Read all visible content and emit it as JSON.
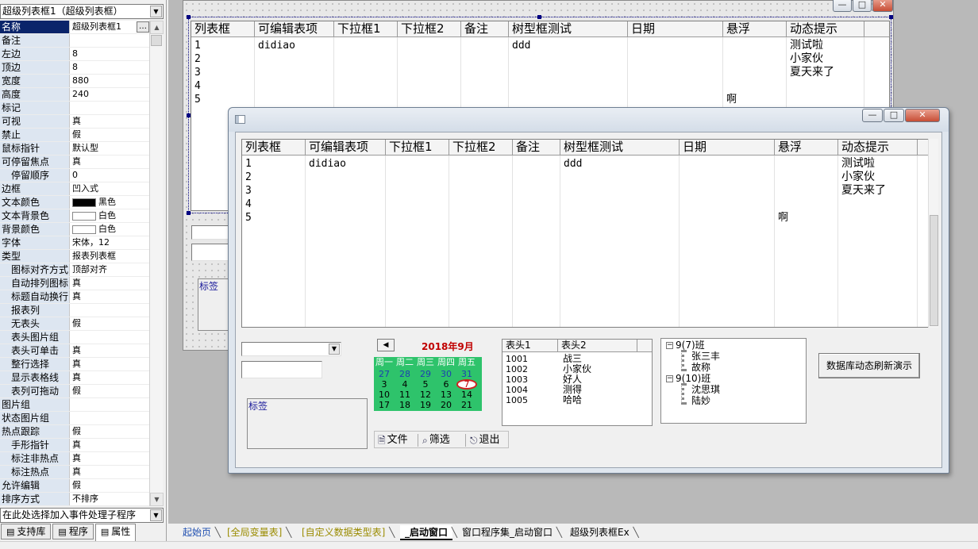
{
  "object_selector": {
    "value": "超级列表框1（超级列表框）"
  },
  "properties": [
    {
      "name": "名称",
      "value": "超级列表框1",
      "selected": true,
      "sub": false
    },
    {
      "name": "备注",
      "value": "",
      "sub": false
    },
    {
      "name": "左边",
      "value": "8",
      "sub": false
    },
    {
      "name": "顶边",
      "value": "8",
      "sub": false
    },
    {
      "name": "宽度",
      "value": "880",
      "sub": false
    },
    {
      "name": "高度",
      "value": "240",
      "sub": false
    },
    {
      "name": "标记",
      "value": "",
      "sub": false
    },
    {
      "name": "可视",
      "value": "真",
      "sub": false
    },
    {
      "name": "禁止",
      "value": "假",
      "sub": false
    },
    {
      "name": "鼠标指针",
      "value": "默认型",
      "sub": false
    },
    {
      "name": "可停留焦点",
      "value": "真",
      "sub": false
    },
    {
      "name": "停留顺序",
      "value": "0",
      "sub": true
    },
    {
      "name": "边框",
      "value": "凹入式",
      "sub": false
    },
    {
      "name": "文本颜色",
      "value": "黑色",
      "swatch": "#000000",
      "sub": false
    },
    {
      "name": "文本背景色",
      "value": "白色",
      "swatch": "#ffffff",
      "sub": false
    },
    {
      "name": "背景颜色",
      "value": "白色",
      "swatch": "#ffffff",
      "sub": false
    },
    {
      "name": "字体",
      "value": "宋体，12",
      "sub": false
    },
    {
      "name": "类型",
      "value": "报表列表框",
      "sub": false
    },
    {
      "name": "图标对齐方式",
      "value": "顶部对齐",
      "sub": true
    },
    {
      "name": "自动排列图标",
      "value": "真",
      "sub": true
    },
    {
      "name": "标题自动换行",
      "value": "真",
      "sub": true
    },
    {
      "name": "报表列",
      "value": "",
      "sub": true
    },
    {
      "name": "无表头",
      "value": "假",
      "sub": true
    },
    {
      "name": "表头图片组",
      "value": "",
      "sub": true
    },
    {
      "name": "表头可单击",
      "value": "真",
      "sub": true
    },
    {
      "name": "整行选择",
      "value": "真",
      "sub": true
    },
    {
      "name": "显示表格线",
      "value": "真",
      "sub": true
    },
    {
      "name": "表列可拖动",
      "value": "假",
      "sub": true
    },
    {
      "name": "图片组",
      "value": "",
      "sub": false
    },
    {
      "name": "状态图片组",
      "value": "",
      "sub": false
    },
    {
      "name": "热点跟踪",
      "value": "假",
      "sub": false
    },
    {
      "name": "手形指针",
      "value": "真",
      "sub": true
    },
    {
      "name": "标注非热点",
      "value": "真",
      "sub": true
    },
    {
      "name": "标注热点",
      "value": "真",
      "sub": true
    },
    {
      "name": "允许编辑",
      "value": "假",
      "sub": false
    },
    {
      "name": "排序方式",
      "value": "不排序",
      "sub": false
    }
  ],
  "event_selector": {
    "value": "在此处选择加入事件处理子程序"
  },
  "bottom_tabs": [
    {
      "label": "支持库",
      "icon": "library-icon"
    },
    {
      "label": "程序",
      "icon": "program-icon"
    },
    {
      "label": "属性",
      "icon": "properties-icon",
      "active": true
    }
  ],
  "grid": {
    "columns": [
      "列表框",
      "可编辑表项",
      "下拉框1",
      "下拉框2",
      "备注",
      "树型框测试",
      "日期",
      "悬浮",
      "动态提示"
    ],
    "rows": [
      {
        "id": "1",
        "editable": "didiao",
        "tree": "ddd",
        "float": "",
        "tip": "测试啦"
      },
      {
        "id": "2",
        "editable": "",
        "tree": "",
        "float": "",
        "tip": "小家伙"
      },
      {
        "id": "3",
        "editable": "",
        "tree": "",
        "float": "",
        "tip": "夏天来了"
      },
      {
        "id": "4",
        "editable": "",
        "tree": "",
        "float": "",
        "tip": ""
      },
      {
        "id": "5",
        "editable": "",
        "tree": "",
        "float": "啊",
        "tip": ""
      }
    ]
  },
  "designer": {
    "label_text": "标签"
  },
  "run_window": {
    "label_text": "标签",
    "calendar": {
      "title": "2018年9月",
      "weekdays": [
        "周一",
        "周二",
        "周三",
        "周四",
        "周五",
        "周"
      ],
      "rows": [
        [
          "27",
          "28",
          "29",
          "30",
          "31",
          "1"
        ],
        [
          "3",
          "4",
          "5",
          "6",
          "7",
          ""
        ],
        [
          "10",
          "11",
          "12",
          "13",
          "14",
          ""
        ],
        [
          "17",
          "18",
          "19",
          "20",
          "21",
          ""
        ]
      ],
      "bg_color": "#2ec36b"
    },
    "list": {
      "headers": [
        "表头1",
        "表头2"
      ],
      "rows": [
        [
          "1001",
          "战三"
        ],
        [
          "1002",
          "小家伙"
        ],
        [
          "1003",
          "好人"
        ],
        [
          "1004",
          "测得"
        ],
        [
          "1005",
          "哈哈"
        ]
      ]
    },
    "toolbar": [
      {
        "label": "文件",
        "icon": "file-icon"
      },
      {
        "label": "筛选",
        "icon": "filter-icon"
      },
      {
        "label": "退出",
        "icon": "exit-icon"
      }
    ],
    "tree": [
      {
        "label": "9(7)班",
        "level": 0
      },
      {
        "label": "张三丰",
        "level": 1
      },
      {
        "label": "故称",
        "level": 1
      },
      {
        "label": "9(10)班",
        "level": 0
      },
      {
        "label": "沈思琪",
        "level": 1
      },
      {
        "label": "陆妙",
        "level": 1
      }
    ],
    "refresh_button": "数据库动态刷新演示"
  },
  "page_tabs": [
    {
      "label": "起始页",
      "color": "#1f4fb0"
    },
    {
      "label": "[全局变量表]",
      "color": "#9a8b00"
    },
    {
      "label": "[自定义数据类型表]",
      "color": "#9a8b00"
    },
    {
      "label": "_启动窗口",
      "color": "#000000",
      "active": true
    },
    {
      "label": "窗口程序集_启动窗口",
      "color": "#000000"
    },
    {
      "label": "超级列表框Ex",
      "color": "#000000"
    }
  ]
}
